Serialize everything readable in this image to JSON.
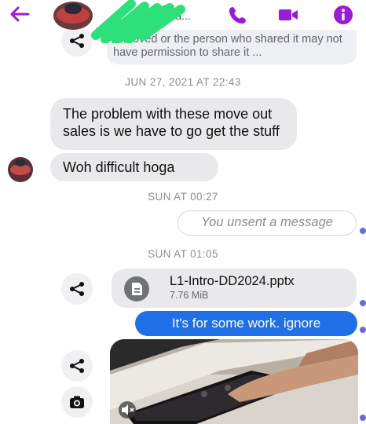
{
  "header": {
    "subtitle_fragment": "urs a...",
    "icons": [
      "back-arrow-icon",
      "phone-icon",
      "video-icon",
      "info-icon"
    ],
    "accent": "#9b1bd6"
  },
  "shared_notice": {
    "text": "removed or the person who shared it may not have permission to share it ..."
  },
  "timestamps": {
    "t1": "JUN 27, 2021 AT 22:43",
    "t2": "SUN AT 00:27",
    "t3": "SUN AT 01:05"
  },
  "messages": {
    "m1": "The problem with these move out sales is we have to go get the stuff",
    "m2": "Woh difficult hoga",
    "unsent": "You unsent a message",
    "file_name": "L1-Intro-DD2024.pptx",
    "file_size": "7.76 MiB",
    "out1": "It's for some work. ignore"
  },
  "colors": {
    "outgoing": "#1e6fe8",
    "incoming": "#e9e9eb",
    "accent": "#9b1bd6"
  }
}
